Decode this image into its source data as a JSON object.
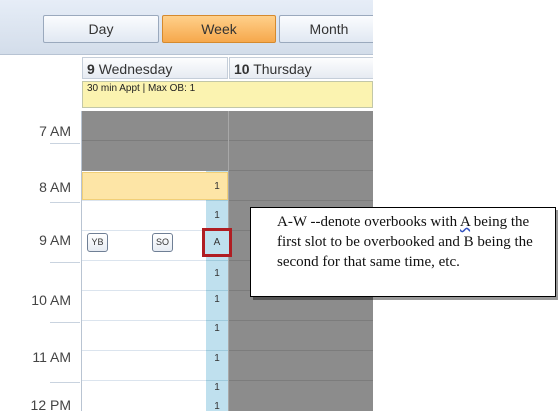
{
  "toolbar": {
    "views": [
      {
        "label": "Day",
        "active": false
      },
      {
        "label": "Week",
        "active": true
      },
      {
        "label": "Month",
        "active": false
      }
    ]
  },
  "columns": [
    {
      "day_num": "9",
      "day_name": "Wednesday"
    },
    {
      "day_num": "10",
      "day_name": "Thursday"
    }
  ],
  "appointment_template": {
    "label": "30 min Appt | Max OB: 1",
    "color": "#fbf3b0"
  },
  "times": [
    "7 AM",
    "8 AM",
    "9 AM",
    "10 AM",
    "11 AM",
    "12 PM"
  ],
  "overbook_counts": [
    "1",
    "1",
    "1",
    "1",
    "1",
    "1",
    "1",
    "1"
  ],
  "slot_chips": [
    "YB",
    "SO"
  ],
  "overbook_marker": "A",
  "annotation": {
    "pre": "A-W --denote overbooks with ",
    "letter": "A",
    "post": " being the first slot to be overbooked and B being the second for that same time, etc."
  },
  "colors": {
    "active_view": "#f6a84c",
    "unavailable": "#8c8c8c",
    "overbook_strip": "#bfe0ee",
    "highlight": "#fde5a6",
    "marker_border": "#b01d22"
  }
}
